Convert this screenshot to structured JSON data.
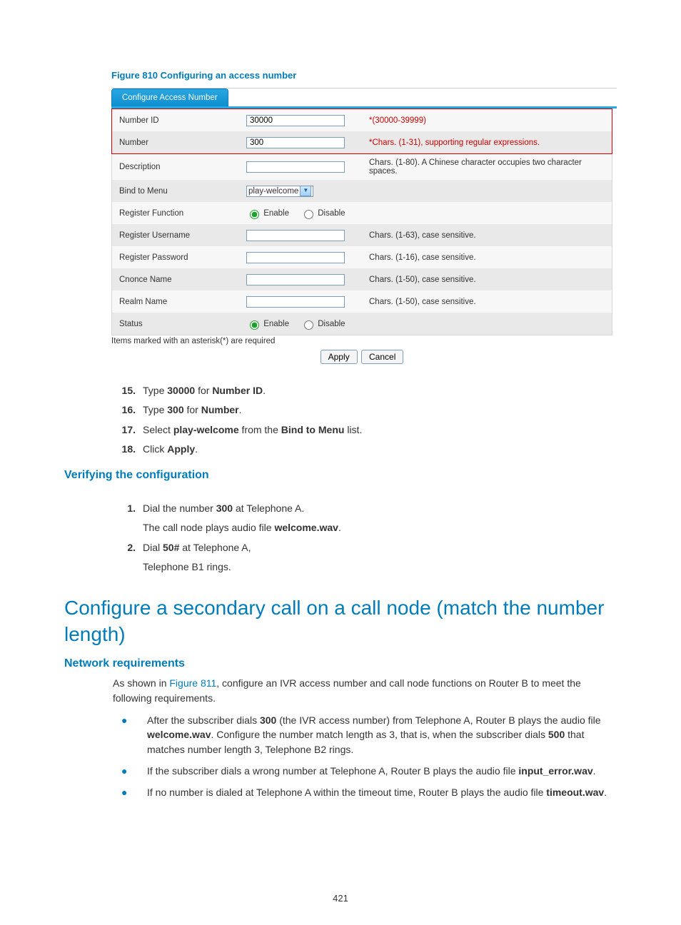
{
  "figure": "Figure 810 Configuring an access number",
  "form": {
    "tab": "Configure Access Number",
    "rows": [
      {
        "label": "Number ID",
        "value": "30000",
        "hint": "*(30000-39999)",
        "hint_red": true,
        "red_outline": true
      },
      {
        "label": "Number",
        "value": "300",
        "hint": "*Chars. (1-31), supporting regular expressions.",
        "hint_red": true,
        "red_outline": true
      },
      {
        "label": "Description",
        "value": "",
        "hint": "Chars. (1-80). A Chinese character occupies two character spaces."
      },
      {
        "label": "Bind to Menu",
        "select": "play-welcome"
      },
      {
        "label": "Register Function",
        "radio_enable": true
      },
      {
        "label": "Register Username",
        "value": "",
        "hint": "Chars. (1-63), case sensitive."
      },
      {
        "label": "Register Password",
        "value": "",
        "hint": "Chars. (1-16), case sensitive."
      },
      {
        "label": "Cnonce Name",
        "value": "",
        "hint": "Chars. (1-50), case sensitive."
      },
      {
        "label": "Realm Name",
        "value": "",
        "hint": "Chars. (1-50), case sensitive."
      },
      {
        "label": "Status",
        "radio_enable": true
      }
    ],
    "required_note": "Items marked with an asterisk(*) are required",
    "radio_labels": {
      "enable": "Enable",
      "disable": "Disable"
    },
    "buttons": {
      "apply": "Apply",
      "cancel": "Cancel"
    }
  },
  "steps1": [
    {
      "n": "15.",
      "parts": [
        "Type ",
        "30000",
        " for ",
        "Number ID",
        "."
      ]
    },
    {
      "n": "16.",
      "parts": [
        "Type ",
        "300",
        " for ",
        "Number",
        "."
      ]
    },
    {
      "n": "17.",
      "parts": [
        "Select ",
        "play-welcome",
        " from the ",
        "Bind to Menu",
        " list."
      ]
    },
    {
      "n": "18.",
      "parts": [
        "Click ",
        "Apply",
        "."
      ]
    }
  ],
  "h3a": "Verifying the configuration",
  "steps2": {
    "s1_n": "1.",
    "s1a": "Dial the number ",
    "s1b": "300",
    "s1c": " at Telephone A.",
    "s1_sub_a": "The call node plays audio file ",
    "s1_sub_b": "welcome.wav",
    "s1_sub_c": ".",
    "s2_n": "2.",
    "s2a": "Dial ",
    "s2b": "50#",
    "s2c": " at Telephone A,",
    "s2_sub": "Telephone B1 rings."
  },
  "h2": "Configure a secondary call on a call node (match the number length)",
  "h3b": "Network requirements",
  "intro": {
    "a": "As shown in ",
    "link": "Figure 811",
    "b": ", configure an IVR access number and call node functions on Router B to meet the following requirements."
  },
  "bullets": {
    "b1": {
      "a": "After the subscriber dials ",
      "b": "300",
      "c": " (the IVR access number) from Telephone A, Router B plays the audio file ",
      "d": "welcome.wav",
      "e": ". Configure the number match length as 3, that is, when the subscriber dials ",
      "f": "500",
      "g": " that matches number length 3, Telephone B2 rings."
    },
    "b2": {
      "a": "If the subscriber dials a wrong number at Telephone A, Router B plays the audio file ",
      "b": "input_error.wav",
      "c": "."
    },
    "b3": {
      "a": "If no number is dialed at Telephone A within the timeout time, Router B plays the audio file ",
      "b": "timeout.wav",
      "c": "."
    }
  },
  "page_number": "421"
}
